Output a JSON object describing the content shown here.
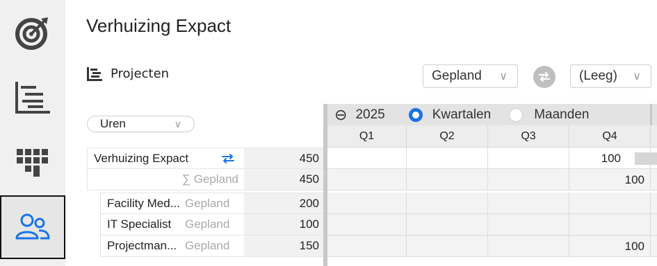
{
  "sidebar": {
    "items": [
      {
        "name": "target-icon"
      },
      {
        "name": "gantt-list-icon"
      },
      {
        "name": "grid-blocks-icon"
      },
      {
        "name": "people-icon",
        "active": true
      }
    ]
  },
  "header": {
    "title": "Verhuizing Expact"
  },
  "section": {
    "label": "Projecten"
  },
  "filters": {
    "planned": "Gepland",
    "planned_chevron": "∨",
    "compare": "(Leeg)",
    "compare_chevron": "∨"
  },
  "unit_select": {
    "value": "Uren",
    "chevron": "∨"
  },
  "grid_header": {
    "collapse_symbol": "⊖",
    "year": "2025",
    "option_quarters": "Kwartalen",
    "option_months": "Maanden",
    "selected": "Kwartalen"
  },
  "quarters": [
    "Q1",
    "Q2",
    "Q3",
    "Q4"
  ],
  "rows": [
    {
      "name": "Verhuizing Expact",
      "type": "",
      "total": "450",
      "cells": [
        "",
        "",
        "",
        "100"
      ]
    },
    {
      "name": "",
      "type": "∑ Gepland",
      "total": "450",
      "cells": [
        "",
        "",
        "",
        "100"
      ]
    },
    {
      "name": "Facility Med...",
      "type": "Gepland",
      "total": "200",
      "cells": [
        "",
        "",
        "",
        ""
      ]
    },
    {
      "name": "IT Specialist",
      "type": "Gepland",
      "total": "100",
      "cells": [
        "",
        "",
        "",
        ""
      ]
    },
    {
      "name": "Projectman...",
      "type": "Gepland",
      "total": "150",
      "cells": [
        "",
        "",
        "",
        "100"
      ]
    }
  ],
  "colors": {
    "accent": "#1a73e8",
    "swap_icon": "#bfbfbf"
  }
}
